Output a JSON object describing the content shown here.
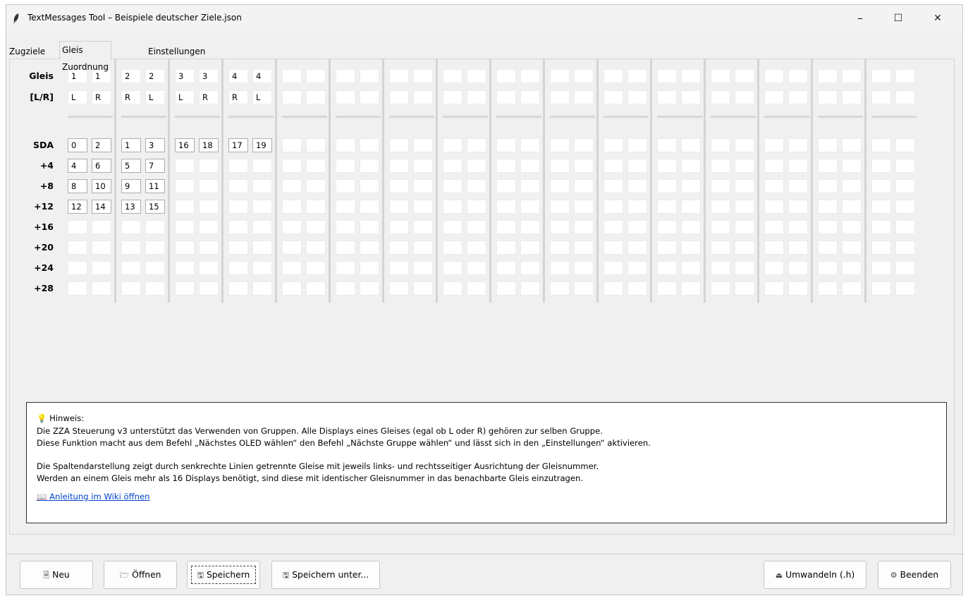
{
  "window": {
    "title": "TextMessages Tool – Beispiele deutscher Ziele.json",
    "minimize": "–",
    "maximize": "☐",
    "close": "✕"
  },
  "tabs": [
    {
      "label": "Zugziele"
    },
    {
      "label": "Gleis Zuordnung"
    },
    {
      "label": "Einstellungen"
    }
  ],
  "grid": {
    "labels": {
      "gleis": "Gleis",
      "lr": "[L/R]",
      "offsets": [
        "SDA",
        "+4",
        "+8",
        "+12",
        "+16",
        "+20",
        "+24",
        "+28"
      ]
    },
    "gleis": [
      "1",
      "1",
      "2",
      "2",
      "3",
      "3",
      "4",
      "4",
      "",
      "",
      "",
      "",
      "",
      "",
      "",
      "",
      "",
      "",
      "",
      "",
      "",
      "",
      "",
      "",
      "",
      "",
      "",
      "",
      "",
      "",
      "",
      ""
    ],
    "lr": [
      "L",
      "R",
      "R",
      "L",
      "L",
      "R",
      "R",
      "L",
      "",
      "",
      "",
      "",
      "",
      "",
      "",
      "",
      "",
      "",
      "",
      "",
      "",
      "",
      "",
      "",
      "",
      "",
      "",
      "",
      "",
      "",
      "",
      ""
    ],
    "sda": [
      [
        "0",
        "2",
        "1",
        "3",
        "16",
        "18",
        "17",
        "19",
        "",
        "",
        "",
        "",
        "",
        "",
        "",
        "",
        "",
        "",
        "",
        "",
        "",
        "",
        "",
        "",
        "",
        "",
        "",
        "",
        "",
        "",
        "",
        ""
      ],
      [
        "4",
        "6",
        "5",
        "7",
        "",
        "",
        "",
        "",
        "",
        "",
        "",
        "",
        "",
        "",
        "",
        "",
        "",
        "",
        "",
        "",
        "",
        "",
        "",
        "",
        "",
        "",
        "",
        "",
        "",
        "",
        "",
        ""
      ],
      [
        "8",
        "10",
        "9",
        "11",
        "",
        "",
        "",
        "",
        "",
        "",
        "",
        "",
        "",
        "",
        "",
        "",
        "",
        "",
        "",
        "",
        "",
        "",
        "",
        "",
        "",
        "",
        "",
        "",
        "",
        "",
        "",
        ""
      ],
      [
        "12",
        "14",
        "13",
        "15",
        "",
        "",
        "",
        "",
        "",
        "",
        "",
        "",
        "",
        "",
        "",
        "",
        "",
        "",
        "",
        "",
        "",
        "",
        "",
        "",
        "",
        "",
        "",
        "",
        "",
        "",
        "",
        ""
      ],
      [
        "",
        "",
        "",
        "",
        "",
        "",
        "",
        "",
        "",
        "",
        "",
        "",
        "",
        "",
        "",
        "",
        "",
        "",
        "",
        "",
        "",
        "",
        "",
        "",
        "",
        "",
        "",
        "",
        "",
        "",
        "",
        ""
      ],
      [
        "",
        "",
        "",
        "",
        "",
        "",
        "",
        "",
        "",
        "",
        "",
        "",
        "",
        "",
        "",
        "",
        "",
        "",
        "",
        "",
        "",
        "",
        "",
        "",
        "",
        "",
        "",
        "",
        "",
        "",
        "",
        ""
      ],
      [
        "",
        "",
        "",
        "",
        "",
        "",
        "",
        "",
        "",
        "",
        "",
        "",
        "",
        "",
        "",
        "",
        "",
        "",
        "",
        "",
        "",
        "",
        "",
        "",
        "",
        "",
        "",
        "",
        "",
        "",
        "",
        ""
      ],
      [
        "",
        "",
        "",
        "",
        "",
        "",
        "",
        "",
        "",
        "",
        "",
        "",
        "",
        "",
        "",
        "",
        "",
        "",
        "",
        "",
        "",
        "",
        "",
        "",
        "",
        "",
        "",
        "",
        "",
        "",
        "",
        ""
      ]
    ]
  },
  "note": {
    "header": "💡 Hinweis:",
    "lines": [
      "Die ZZA Steuerung v3 unterstützt das Verwenden von Gruppen. Alle Displays eines Gleises (egal ob L oder R) gehören zur selben Gruppe.",
      "Diese Funktion macht aus dem Befehl „Nächstes OLED wählen“ den Befehl „Nächste Gruppe wählen“ und lässt sich in den „Einstellungen“ aktivieren.",
      "",
      "Die Spaltendarstellung zeigt durch senkrechte Linien getrennte Gleise mit jeweils links- und rechtsseitiger Ausrichtung der Gleisnummer.",
      "Werden an einem Gleis mehr als 16 Displays benötigt, sind diese mit identischer Gleisnummer in das benachbarte Gleis einzutragen."
    ],
    "link": "📖 Anleitung im Wiki öffnen"
  },
  "buttons": {
    "neu": {
      "icon": "🗎",
      "label": "Neu"
    },
    "oeffnen": {
      "icon": "🗁",
      "label": "Öffnen"
    },
    "speichern": {
      "icon": "🖫",
      "label": "Speichern"
    },
    "speichern_unter": {
      "icon": "🖫",
      "label": "Speichern unter..."
    },
    "umwandeln": {
      "icon": "⏏",
      "label": "Umwandeln (.h)"
    },
    "beenden": {
      "icon": "⚙",
      "label": "Beenden"
    }
  }
}
